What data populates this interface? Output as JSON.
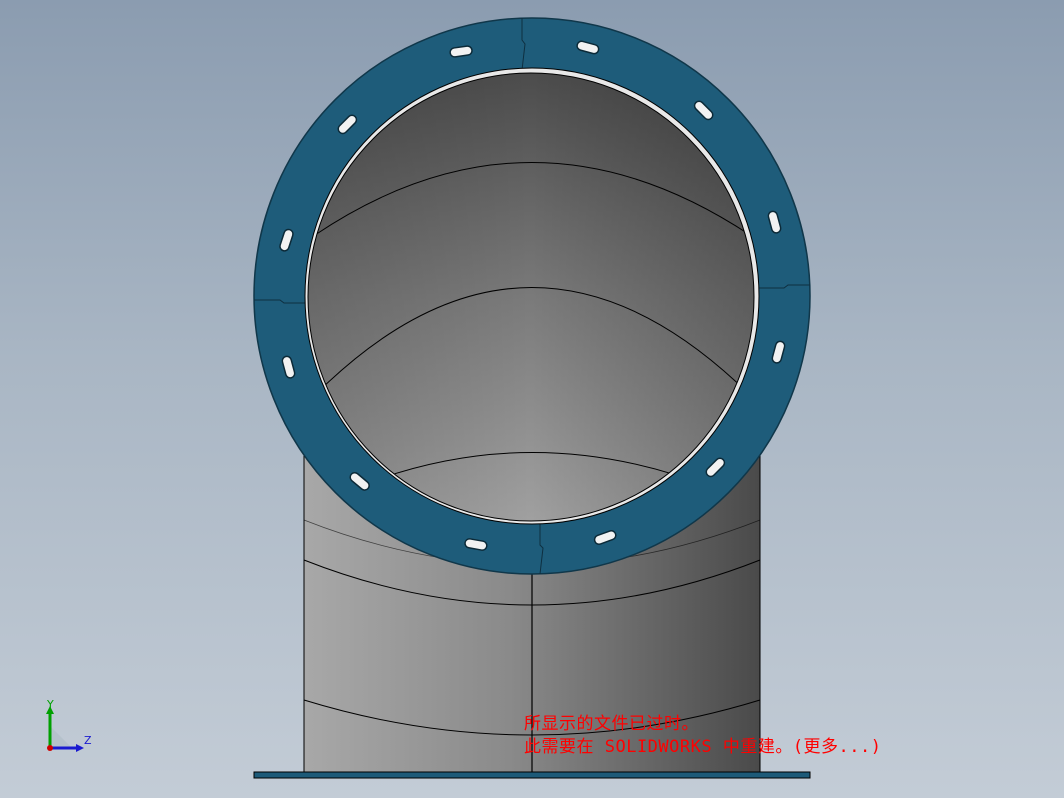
{
  "viewport": {
    "model": "pipe-elbow-with-flange",
    "colors": {
      "background_top": "#8b9cb0",
      "background_bottom": "#c3ccd6",
      "flange": "#1d5a78",
      "pipe_light": "#9c9c9c",
      "pipe_dark": "#4e4e4e",
      "edge": "#000000"
    }
  },
  "messages": {
    "line1": "所显示的文件已过时。",
    "line2": "此需要在 SOLIDWORKS 中重建。(更多...)"
  },
  "triad": {
    "y_label": "Y",
    "z_label": "Z",
    "colors": {
      "y": "#00a000",
      "z": "#1a1ad0",
      "origin": "#d00000"
    }
  }
}
